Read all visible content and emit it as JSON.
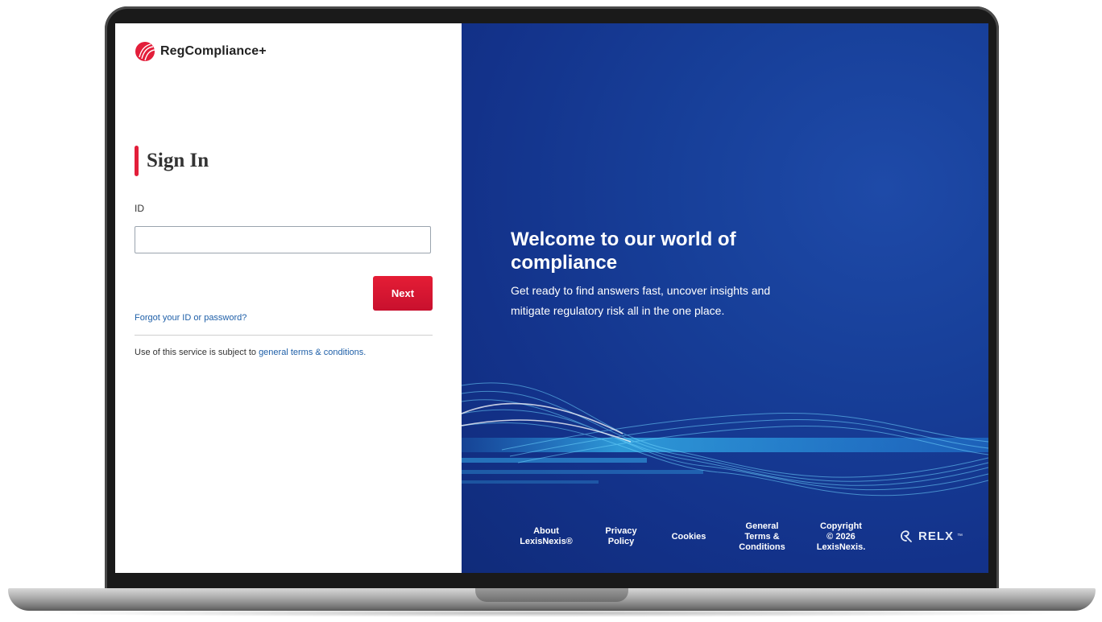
{
  "brand": {
    "name": "RegCompliance+",
    "logo_icon": "lexisnexis-logo-icon",
    "color": "#e31e3a"
  },
  "signin": {
    "title": "Sign In",
    "id_label": "ID",
    "id_value": "",
    "id_placeholder": "",
    "next_label": "Next"
  },
  "links": {
    "forgot": "Forgot your ID or password?"
  },
  "terms": {
    "prefix": "Use of this service is subject to ",
    "link": "general terms & conditions."
  },
  "hero": {
    "title": "Welcome to our world of compliance",
    "subtitle": "Get ready to find answers fast, uncover insights and mitigate regulatory risk all in the one place."
  },
  "footer": {
    "about": [
      "About",
      "LexisNexis®"
    ],
    "privacy": [
      "Privacy",
      "Policy"
    ],
    "cookies": [
      "Cookies"
    ],
    "terms": [
      "General",
      "Terms &",
      "Conditions"
    ],
    "copyright": [
      "Copyright",
      "© 2026",
      "LexisNexis."
    ],
    "relx": "RELX",
    "relx_tm": "™"
  },
  "colors": {
    "accent": "#e31e3a",
    "link": "#1e5fa8",
    "hero_bg": "#173f99"
  }
}
